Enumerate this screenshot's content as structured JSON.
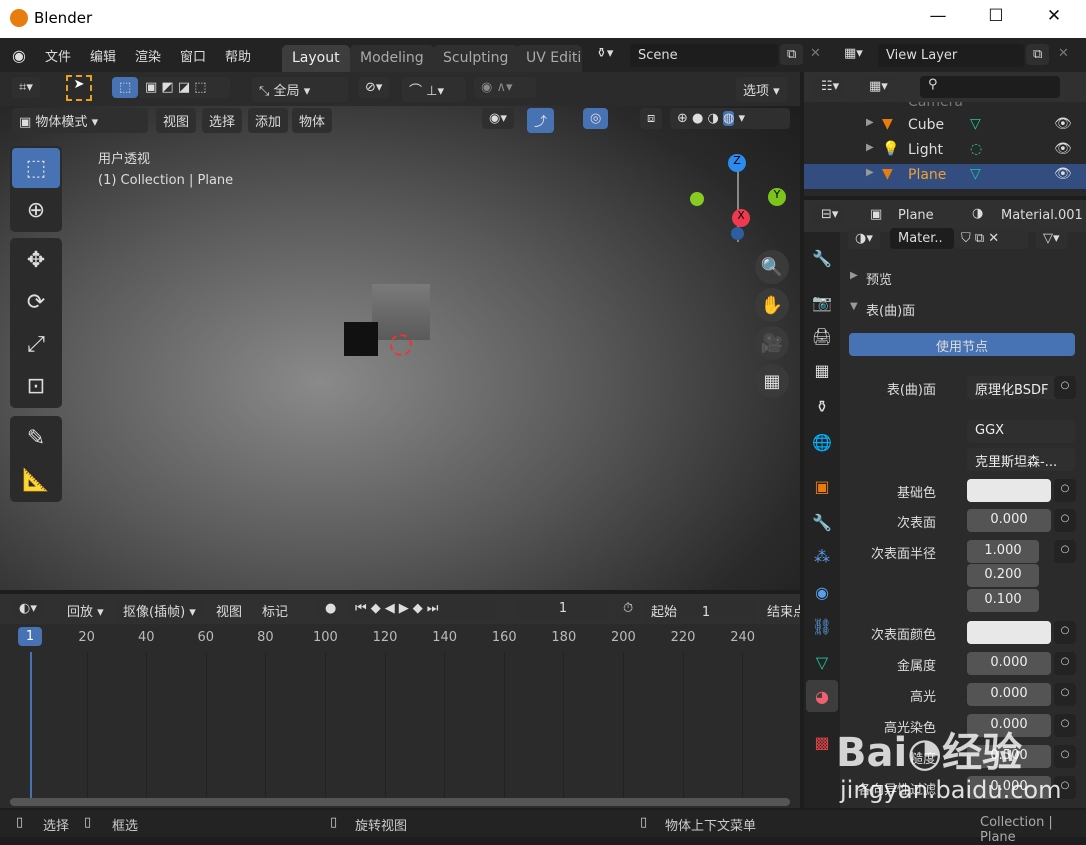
{
  "window": {
    "title": "Blender",
    "controls": [
      "—",
      "☐",
      "✕"
    ]
  },
  "menu": [
    "文件",
    "编辑",
    "渲染",
    "窗口",
    "帮助"
  ],
  "workspaces": [
    "Layout",
    "Modeling",
    "Sculpting",
    "UV Editir"
  ],
  "scene": "Scene",
  "view_layer": "View Layer",
  "toolbar": {
    "orientation": "全局",
    "options": "选项"
  },
  "viewport": {
    "mode": "物体模式",
    "menus": [
      "视图",
      "选择",
      "添加",
      "物体"
    ],
    "view_name": "用户透视",
    "collection": "(1) Collection | Plane",
    "gizmo": {
      "z": "Z",
      "y": "Y",
      "x": "X"
    }
  },
  "timeline": {
    "menus": [
      "回放",
      "抠像(插帧)",
      "视图",
      "标记"
    ],
    "current_frame": "1",
    "start_label": "起始",
    "start": "1",
    "end_label": "结束点",
    "ticks": [
      "1",
      "20",
      "40",
      "60",
      "80",
      "100",
      "120",
      "140",
      "160",
      "180",
      "200",
      "220",
      "240"
    ]
  },
  "outliner": {
    "items": [
      {
        "name": "Camera",
        "selected": false
      },
      {
        "name": "Cube",
        "selected": false
      },
      {
        "name": "Light",
        "selected": false
      },
      {
        "name": "Plane",
        "selected": true
      }
    ]
  },
  "properties": {
    "object": "Plane",
    "material": "Material.001",
    "slot": "Mater..",
    "sections": {
      "preview": "预览",
      "surface": "表(曲)面"
    },
    "use_nodes": "使用节点",
    "rows": [
      {
        "label": "表(曲)面",
        "value": "原理化BSDF"
      },
      {
        "label": "",
        "value": "GGX"
      },
      {
        "label": "",
        "value": "克里斯坦森-..."
      },
      {
        "label": "基础色",
        "value": ""
      },
      {
        "label": "次表面",
        "value": "0.000"
      },
      {
        "label": "次表面半径",
        "value": "1.000"
      },
      {
        "label": "",
        "value": "0.200"
      },
      {
        "label": "",
        "value": "0.100"
      },
      {
        "label": "次表面颜色",
        "value": ""
      },
      {
        "label": "金属度",
        "value": "0.000"
      },
      {
        "label": "高光",
        "value": "0.000"
      },
      {
        "label": "高光染色",
        "value": "0.000"
      },
      {
        "label": "糙度",
        "value": "0.500"
      },
      {
        "label": "各向异性过滤",
        "value": "0.000"
      }
    ]
  },
  "status": {
    "select": "选择",
    "box_select": "框选",
    "rotate": "旋转视图",
    "context_menu": "物体上下文菜单",
    "right": "Collection | Plane"
  },
  "watermark": "Baidu经验 jingyan.baidu.com",
  "colors": {
    "accent": "#4772b3",
    "selected_row": "#334d80",
    "orange": "#e87d0d",
    "teal": "#1ec8a0"
  }
}
